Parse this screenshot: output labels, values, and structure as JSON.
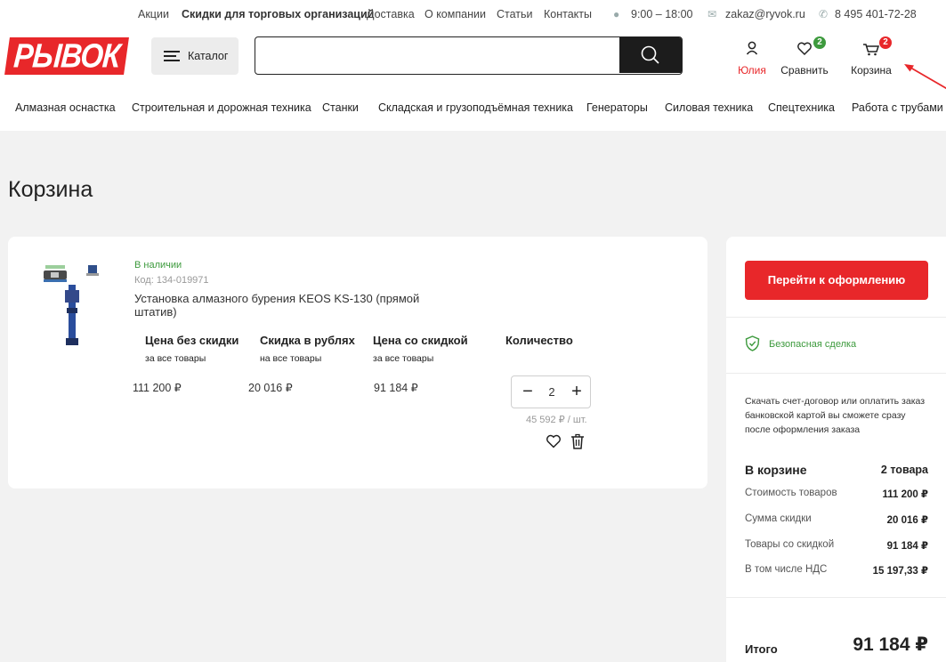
{
  "topbar": {
    "links": [
      "Акции",
      "Скидки для торговых организаций",
      "Доставка",
      "О компании",
      "Статьи",
      "Контакты"
    ],
    "hours": "9:00 – 18:00",
    "email": "zakaz@ryvok.ru",
    "phone": "8 495 401-72-28"
  },
  "header": {
    "logo": "РЫВОК",
    "catalog_label": "Каталог",
    "search_value": "",
    "search_placeholder": "",
    "user_label": "Юлия",
    "compare_label": "Сравнить",
    "compare_count": "2",
    "cart_label": "Корзина",
    "cart_count": "2"
  },
  "catnav": [
    "Алмазная оснастка",
    "Строительная и дорожная техника",
    "Станки",
    "Складская и грузоподъёмная техника",
    "Генераторы",
    "Силовая техника",
    "Спецтехника",
    "Работа с трубами"
  ],
  "page_title": "Корзина",
  "item": {
    "stock": "В наличии",
    "code": "Код: 134-019971",
    "name": "Установка алмазного бурения KEOS KS-130 (прямой штатив)",
    "columns": [
      {
        "title": "Цена без скидки",
        "sub": "за все товары",
        "value": "111 200 ₽"
      },
      {
        "title": "Скидка в рублях",
        "sub": "на все товары",
        "value": "20 016 ₽"
      },
      {
        "title": "Цена со скидкой",
        "sub": "за все товары",
        "value": "91 184 ₽"
      },
      {
        "title": "Количество",
        "sub": "",
        "value": ""
      }
    ],
    "quantity": "2",
    "unit_price": "45 592 ₽ / шт."
  },
  "summary": {
    "checkout_label": "Перейти к оформлению",
    "safe_deal": "Безопасная сделка",
    "note": "Скачать счет-договор или оплатить заказ банковской картой вы сможете сразу после оформления заказа",
    "in_cart_label": "В корзине",
    "in_cart_value": "2 товара",
    "rows": [
      {
        "label": "Стоимость товаров",
        "value": "111 200 ₽"
      },
      {
        "label": "Сумма скидки",
        "value": "20 016 ₽"
      },
      {
        "label": "Товары со скидкой",
        "value": "91 184 ₽"
      },
      {
        "label": "В том числе НДС",
        "value": "15 197,33 ₽"
      }
    ],
    "total_label": "Итого",
    "total_value": "91 184 ₽"
  },
  "colors": {
    "brand_red": "#e8272a",
    "green": "#3d9a3d",
    "dark": "#1c1c1c"
  }
}
